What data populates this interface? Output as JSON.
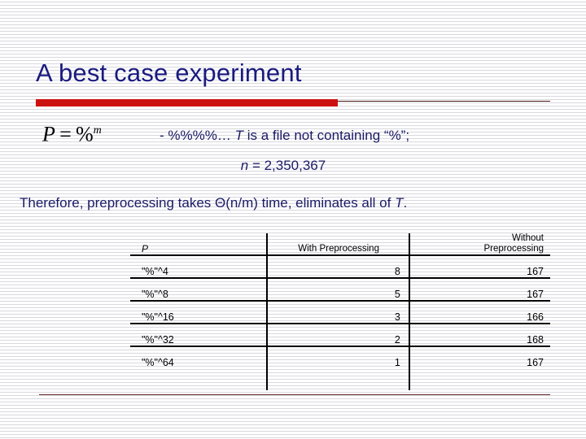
{
  "slide": {
    "title": "A best case experiment",
    "formula": {
      "lhs": "P",
      "equals": "=",
      "base": "%",
      "exponent": "m",
      "plain": "P = %^m"
    },
    "description": "- %%%%… T is a file not containing “%”;",
    "description_parts": {
      "prefix": "- %%%%… ",
      "italic": "T",
      "suffix": " is a file not containing “%”;"
    },
    "n_line": {
      "symbol": "n",
      "equals_value": " = 2,350,367",
      "plain": "n = 2,350,367"
    },
    "therefore_line": {
      "prefix": "Therefore, preprocessing takes Θ(n/m) time, eliminates all of ",
      "italic": "T",
      "suffix": ".",
      "plain": "Therefore, preprocessing takes Θ(n/m) time, eliminates all of T."
    },
    "colors": {
      "title": "#1a1a80",
      "body_text": "#1a1a66",
      "accent_bar": "#cc1111",
      "thin_rule": "#4a1414",
      "bottom_rule": "#6b2a2a",
      "table_rule": "#000000",
      "background": "#ffffff",
      "scanline": "#d8d8de"
    }
  },
  "table": {
    "headers": {
      "pattern": "P",
      "with_preprocessing": "With Preprocessing",
      "without_preprocessing_line1": "Without",
      "without_preprocessing_line2": "Preprocessing"
    },
    "rows": [
      {
        "pattern": "\"%\"^4",
        "with_preprocessing": "8",
        "without_preprocessing": "167"
      },
      {
        "pattern": "\"%\"^8",
        "with_preprocessing": "5",
        "without_preprocessing": "167"
      },
      {
        "pattern": "\"%\"^16",
        "with_preprocessing": "3",
        "without_preprocessing": "166"
      },
      {
        "pattern": "\"%\"^32",
        "with_preprocessing": "2",
        "without_preprocessing": "168"
      },
      {
        "pattern": "\"%\"^64",
        "with_preprocessing": "1",
        "without_preprocessing": "167"
      }
    ]
  },
  "chart_data": {
    "type": "table",
    "title": "A best case experiment",
    "columns": [
      "P",
      "With Preprocessing",
      "Without Preprocessing"
    ],
    "categories": [
      "\"%\"^4",
      "\"%\"^8",
      "\"%\"^16",
      "\"%\"^32",
      "\"%\"^64"
    ],
    "series": [
      {
        "name": "With Preprocessing",
        "values": [
          8,
          5,
          3,
          2,
          1
        ]
      },
      {
        "name": "Without Preprocessing",
        "values": [
          167,
          167,
          166,
          168,
          167
        ]
      }
    ],
    "xlabel": "P",
    "ylabel": "",
    "annotations": [
      "P = %^m",
      "- %%%%… T is a file not containing “%”;",
      "n = 2,350,367",
      "Therefore, preprocessing takes Θ(n/m) time, eliminates all of T."
    ]
  }
}
